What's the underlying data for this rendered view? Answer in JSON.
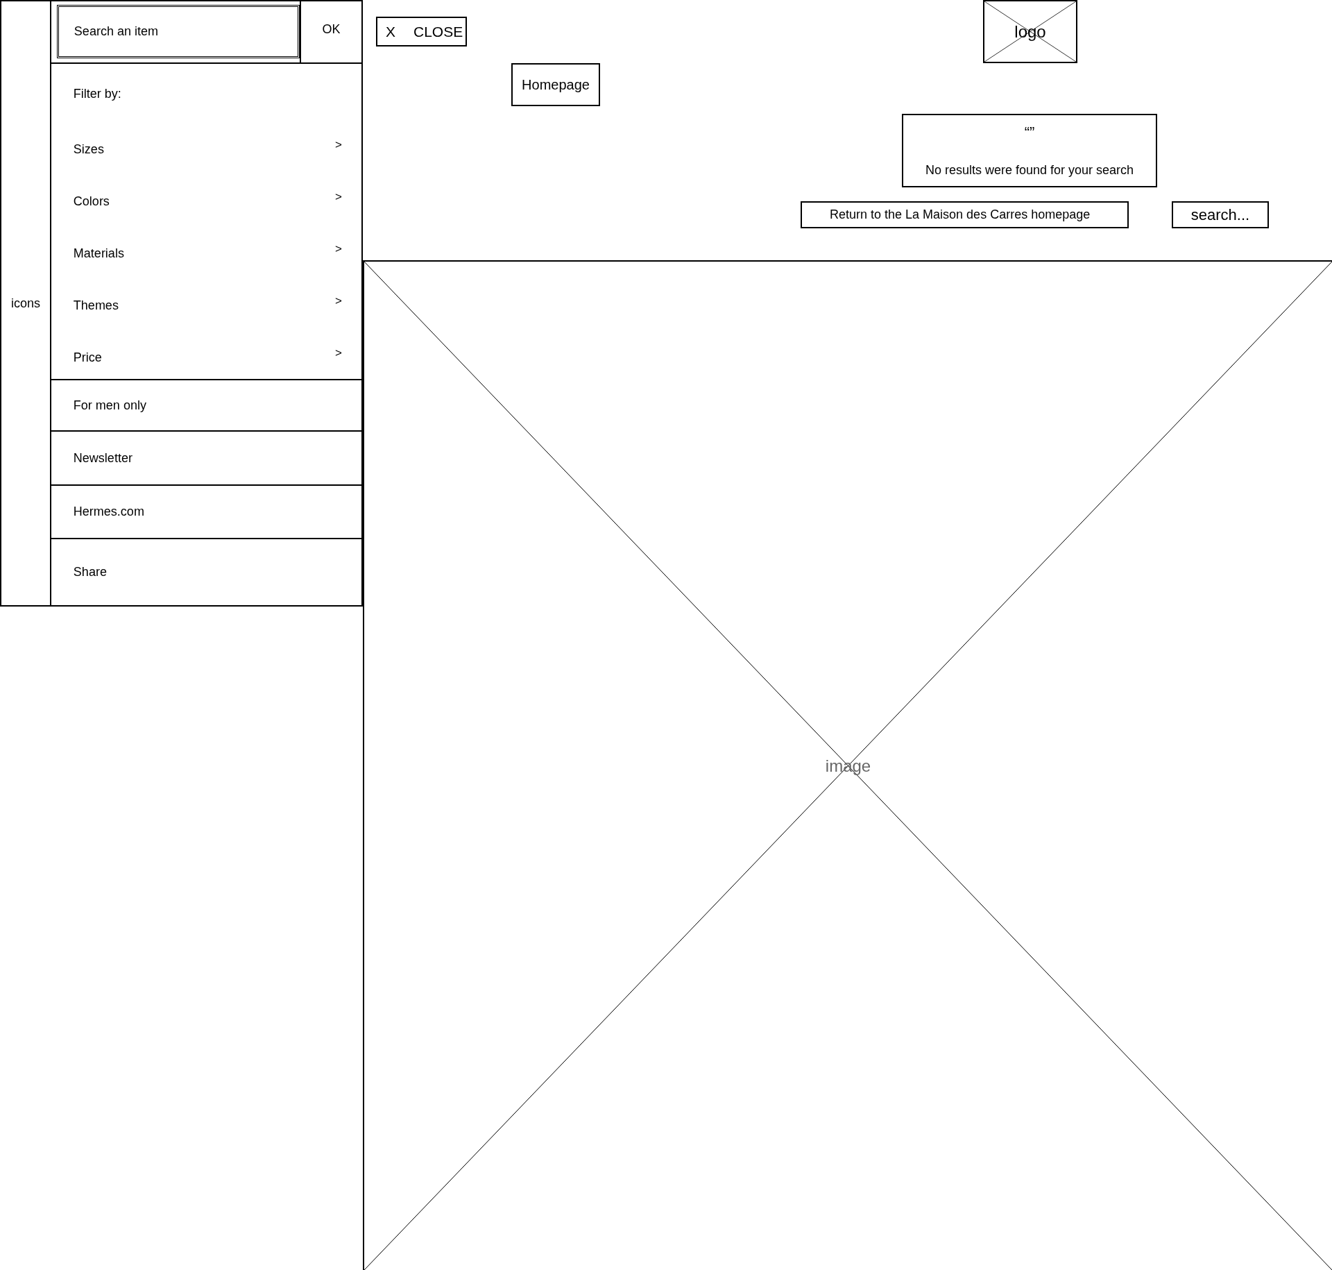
{
  "sidebar": {
    "icons_label": "icons",
    "search": {
      "placeholder": "Search an item"
    },
    "ok_button": "OK",
    "filter_title": "Filter by:",
    "filters": [
      {
        "label": "Sizes",
        "chevron": ">"
      },
      {
        "label": "Colors",
        "chevron": ">"
      },
      {
        "label": "Materials",
        "chevron": ">"
      },
      {
        "label": "Themes",
        "chevron": ">"
      },
      {
        "label": "Price",
        "chevron": ">"
      }
    ],
    "links": [
      "For men only",
      "Newsletter",
      "Hermes.com",
      "Share"
    ]
  },
  "close_button": {
    "icon": "X",
    "label": "CLOSE"
  },
  "logo": "logo",
  "homepage_button": "Homepage",
  "no_results": {
    "quotes": "“”",
    "message": "No results were found for your search"
  },
  "return_button": "Return to the La Maison des Carres homepage",
  "search_button": "search...",
  "image": {
    "label": "image"
  }
}
